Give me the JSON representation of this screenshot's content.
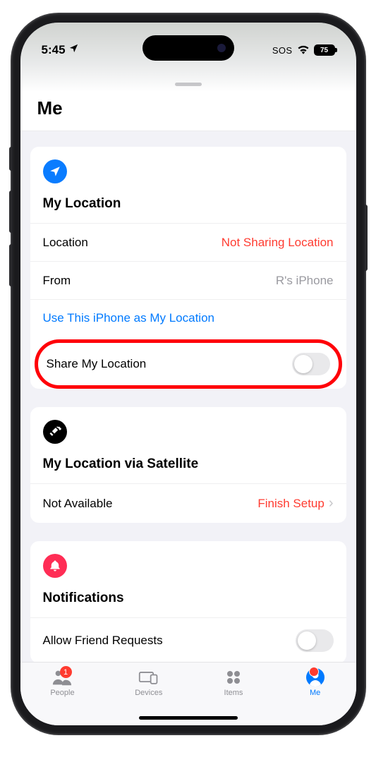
{
  "status": {
    "time": "5:45",
    "sos": "SOS",
    "battery": "75"
  },
  "header": {
    "title": "Me"
  },
  "location_card": {
    "title": "My Location",
    "rows": {
      "location_label": "Location",
      "location_value": "Not Sharing Location",
      "from_label": "From",
      "from_value": "R's iPhone"
    },
    "link": "Use This iPhone as My Location",
    "share_label": "Share My Location"
  },
  "satellite_card": {
    "title": "My Location via Satellite",
    "status_label": "Not Available",
    "action": "Finish Setup"
  },
  "notifications_card": {
    "title": "Notifications",
    "allow_label": "Allow Friend Requests"
  },
  "tabs": {
    "people": "People",
    "devices": "Devices",
    "items": "Items",
    "me": "Me",
    "people_badge": "1"
  }
}
